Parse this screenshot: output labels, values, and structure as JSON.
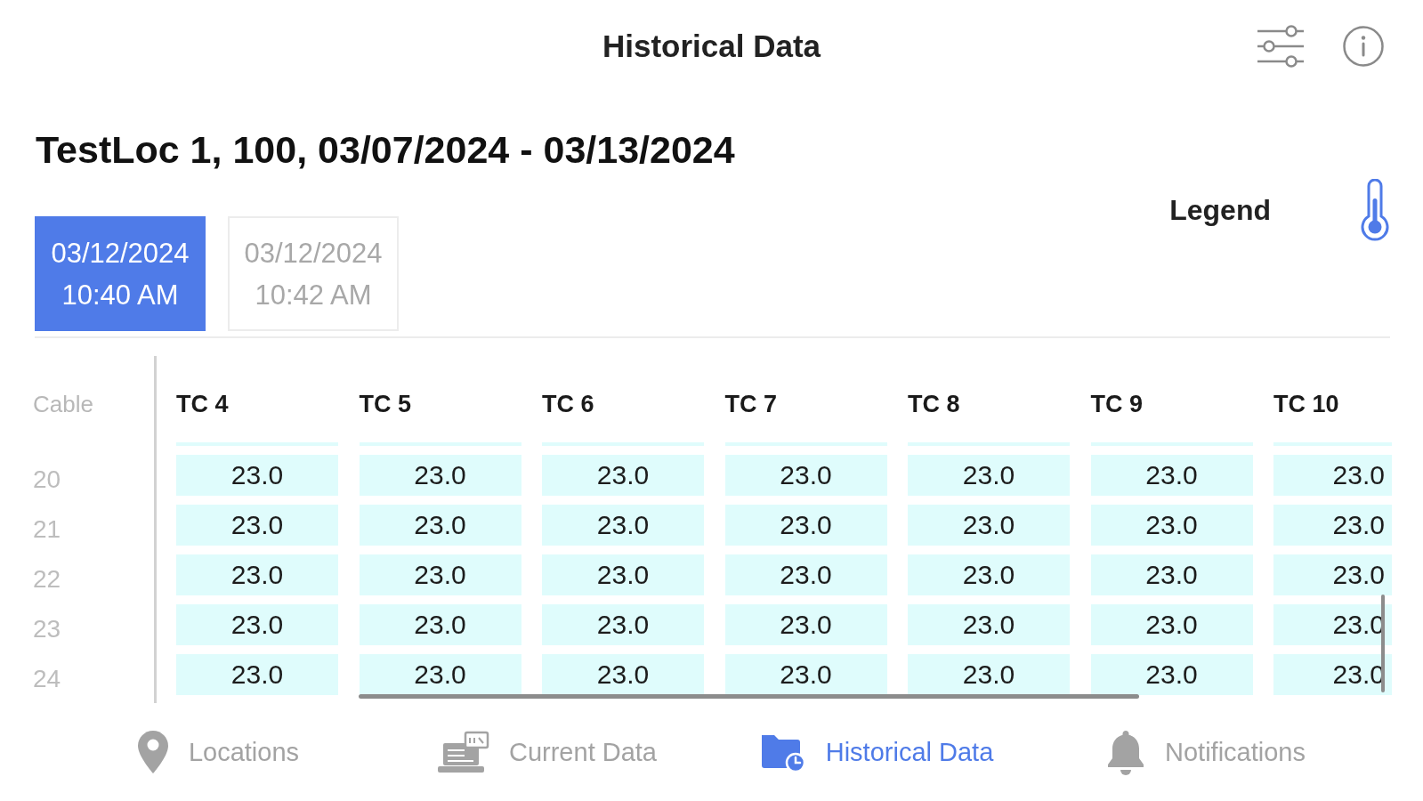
{
  "header": {
    "title": "Historical Data"
  },
  "report": {
    "title": "TestLoc 1, 100, 03/07/2024 - 03/13/2024"
  },
  "timestamps": [
    {
      "date": "03/12/2024",
      "time": "10:40 AM",
      "selected": true
    },
    {
      "date": "03/12/2024",
      "time": "10:42 AM",
      "selected": false
    }
  ],
  "legend": {
    "label": "Legend"
  },
  "table": {
    "row_header": "Cable",
    "columns": [
      "TC 4",
      "TC 5",
      "TC 6",
      "TC 7",
      "TC 8",
      "TC 9",
      "TC 10"
    ],
    "rows": [
      {
        "label": "20",
        "cells": [
          "23.0",
          "23.0",
          "23.0",
          "23.0",
          "23.0",
          "23.0",
          "23.0"
        ]
      },
      {
        "label": "21",
        "cells": [
          "23.0",
          "23.0",
          "23.0",
          "23.0",
          "23.0",
          "23.0",
          "23.0"
        ]
      },
      {
        "label": "22",
        "cells": [
          "23.0",
          "23.0",
          "23.0",
          "23.0",
          "23.0",
          "23.0",
          "23.0"
        ]
      },
      {
        "label": "23",
        "cells": [
          "23.0",
          "23.0",
          "23.0",
          "23.0",
          "23.0",
          "23.0",
          "23.0"
        ]
      },
      {
        "label": "24",
        "cells": [
          "23.0",
          "23.0",
          "23.0",
          "23.0",
          "23.0",
          "23.0",
          "23.0"
        ]
      }
    ]
  },
  "nav": [
    {
      "label": "Locations",
      "selected": false
    },
    {
      "label": "Current Data",
      "selected": false
    },
    {
      "label": "Historical Data",
      "selected": true
    },
    {
      "label": "Notifications",
      "selected": false
    }
  ]
}
